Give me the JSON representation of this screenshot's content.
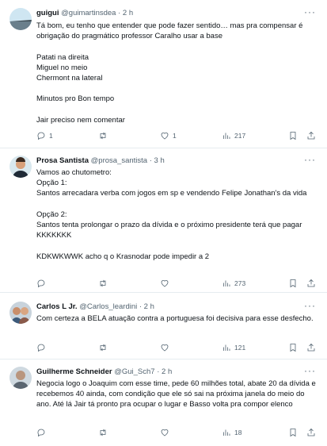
{
  "tweets": [
    {
      "name": "guigui",
      "handle": "@guimartinsdea",
      "time": "· 2 h",
      "lines": [
        "Tá bom, eu tenho que entender que pode fazer sentido… mas pra compensar é obrigação do pragmático professor Caralho usar a base",
        "",
        "Patati na direita",
        "Miguel no meio",
        "Chermont na lateral",
        "",
        "Minutos pro Bon tempo",
        "",
        "Jair preciso nem comentar"
      ],
      "replies": "1",
      "retweets": "",
      "likes": "1",
      "views": "217"
    },
    {
      "name": "Prosa Santista",
      "handle": "@prosa_santista",
      "time": "· 3 h",
      "lines": [
        "Vamos ao chutometro:",
        "Opção 1:",
        "Santos arrecadara verba com jogos em sp e vendendo Felipe Jonathan's da vida",
        "",
        "Opção 2:",
        "Santos tenta prolongar o prazo da dívida e o próximo presidente terá que pagar KKKKKKK",
        "",
        "KDKWKWWK acho q o Krasnodar pode impedir a 2"
      ],
      "replies": "",
      "retweets": "",
      "likes": "",
      "views": "273"
    },
    {
      "name": "Carlos L Jr.",
      "handle": "@Carlos_leardini",
      "time": "· 2 h",
      "lines": [
        "Com certeza a BELA atuação contra a portuguesa foi decisiva para esse desfecho."
      ],
      "replies": "",
      "retweets": "",
      "likes": "",
      "views": "121"
    },
    {
      "name": "Guilherme Schneider",
      "handle": "@Gui_Sch7",
      "time": "· 2 h",
      "lines": [
        "Negocia logo o Joaquim com esse time, pede 60 milhões total, abate 20 da dívida e recebemos 40 ainda, com condição que ele só sai na próxima janela do meio do ano. Até lá Jair tá pronto pra ocupar o lugar e Basso volta pra compor elenco"
      ],
      "replies": "",
      "retweets": "",
      "likes": "",
      "views": "18"
    }
  ],
  "icons": {
    "reply": "reply-icon",
    "retweet": "retweet-icon",
    "like": "heart-icon",
    "views": "views-icon",
    "bookmark": "bookmark-icon",
    "share": "share-icon",
    "more": "more-icon"
  },
  "colors": {
    "text": "#0f1419",
    "secondary": "#536471",
    "divider": "#e6ecf0"
  }
}
